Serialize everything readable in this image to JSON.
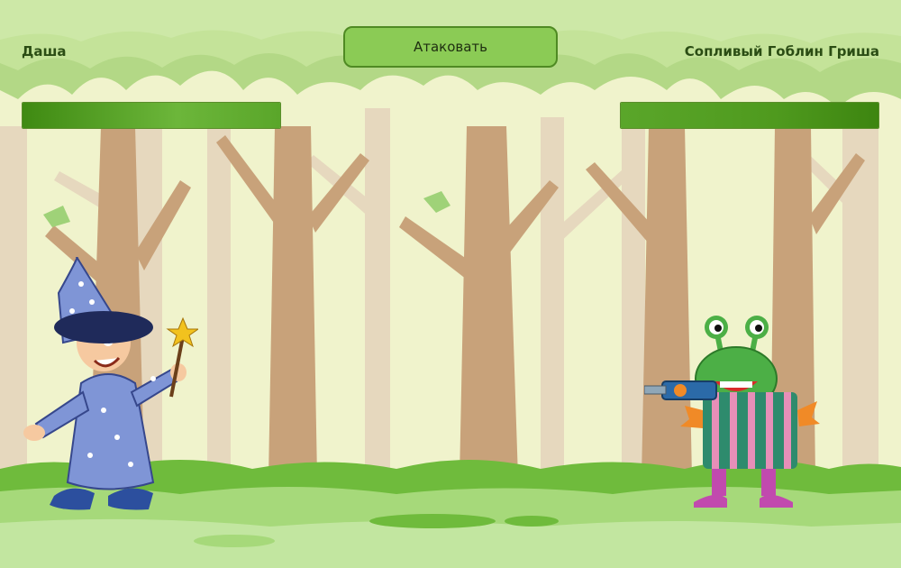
{
  "game": {
    "attack_button": "Атаковать",
    "player1": {
      "name": "Даша",
      "hp_fraction": 1.0
    },
    "player2": {
      "name": "Сопливый Гоблин Гриша",
      "hp_fraction": 1.0
    }
  },
  "colors": {
    "button_fill": "#8bcb55",
    "button_border": "#4f8a23",
    "hp_bar": "#4f9a1e",
    "name_text": "#2b4d14"
  }
}
